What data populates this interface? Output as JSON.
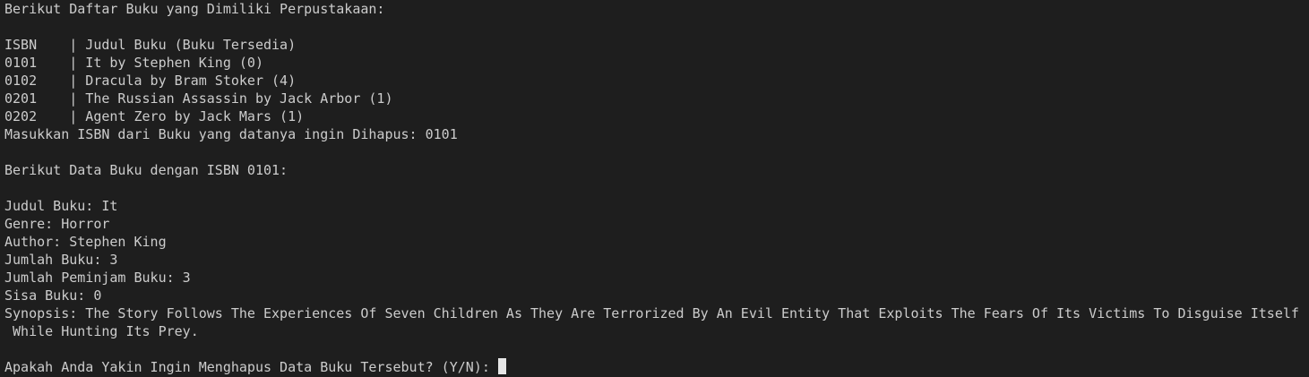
{
  "terminal": {
    "cursor_color": "#e6e6e6",
    "lines": [
      "Berikut Daftar Buku yang Dimiliki Perpustakaan:",
      "",
      "ISBN    | Judul Buku (Buku Tersedia)",
      "0101    | It by Stephen King (0)",
      "0102    | Dracula by Bram Stoker (4)",
      "0201    | The Russian Assassin by Jack Arbor (1)",
      "0202    | Agent Zero by Jack Mars (1)",
      "Masukkan ISBN dari Buku yang datanya ingin Dihapus: 0101",
      "",
      "Berikut Data Buku dengan ISBN 0101:",
      "",
      "Judul Buku: It",
      "Genre: Horror",
      "Author: Stephen King",
      "Jumlah Buku: 3",
      "Jumlah Peminjam Buku: 3",
      "Sisa Buku: 0",
      "Synopsis: The Story Follows The Experiences Of Seven Children As They Are Terrorized By An Evil Entity That Exploits The Fears Of Its Victims To Disguise Itself",
      " While Hunting Its Prey.",
      "",
      "Apakah Anda Yakin Ingin Menghapus Data Buku Tersebut? (Y/N): "
    ]
  }
}
